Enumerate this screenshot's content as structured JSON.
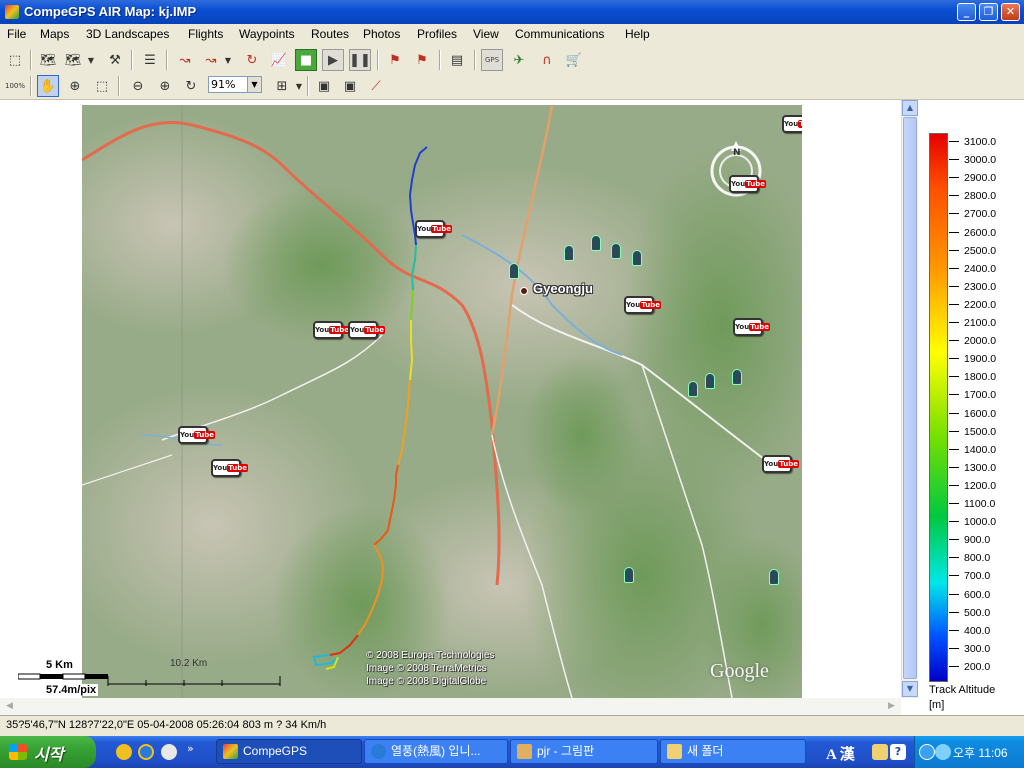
{
  "window": {
    "title": "CompeGPS AIR Map: kj.IMP",
    "controls": {
      "minimize": "_",
      "maximize": "❐",
      "close": "✕"
    }
  },
  "menu": [
    "File",
    "Maps",
    "3D Landscapes",
    "Flights",
    "Waypoints",
    "Routes",
    "Photos",
    "Profiles",
    "View",
    "Communications",
    "Help"
  ],
  "toolbar": {
    "zoom_value": "91%",
    "zoom_100_label": "100%"
  },
  "map": {
    "city_label": "Gyeongju",
    "copyright": [
      "© 2008 Europa Technologies",
      "Image © 2008 TerraMetrics",
      "Image © 2008 DigitalGlobe"
    ],
    "google_logo": "Google",
    "compass_label": "N",
    "scale": {
      "distance": "5 Km",
      "resolution": "57.4m/pix",
      "grid": "10.2 Km"
    },
    "youtube_badge": {
      "you": "You",
      "tube": "Tube"
    }
  },
  "legend": {
    "labels": [
      "3100.0",
      "3000.0",
      "2900.0",
      "2800.0",
      "2700.0",
      "2600.0",
      "2500.0",
      "2400.0",
      "2300.0",
      "2200.0",
      "2100.0",
      "2000.0",
      "1900.0",
      "1800.0",
      "1700.0",
      "1600.0",
      "1500.0",
      "1400.0",
      "1300.0",
      "1200.0",
      "1100.0",
      "1000.0",
      "900.0",
      "800.0",
      "700.0",
      "600.0",
      "500.0",
      "400.0",
      "300.0",
      "200.0"
    ],
    "title": "Track Altitude",
    "unit": "[m]"
  },
  "status": {
    "text": "35?5'46,7\"N 128?7'22,0\"E  05-04-2008  05:26:04  803 m   ?  34 Km/h"
  },
  "taskbar": {
    "start": "시작",
    "tasks": [
      {
        "label": "CompeGPS",
        "active": true
      },
      {
        "label": "열풍(熱風) 입니...",
        "active": false
      },
      {
        "label": "pjr - 그림판",
        "active": false
      },
      {
        "label": "새 폴더",
        "active": false
      }
    ],
    "ime": "A 漢",
    "clock": "오후 11:06"
  },
  "colors": {
    "title_bar": "#0a4fd4",
    "chrome": "#ece9d8",
    "track_high": "#e60000",
    "track_low": "#0000c8"
  }
}
